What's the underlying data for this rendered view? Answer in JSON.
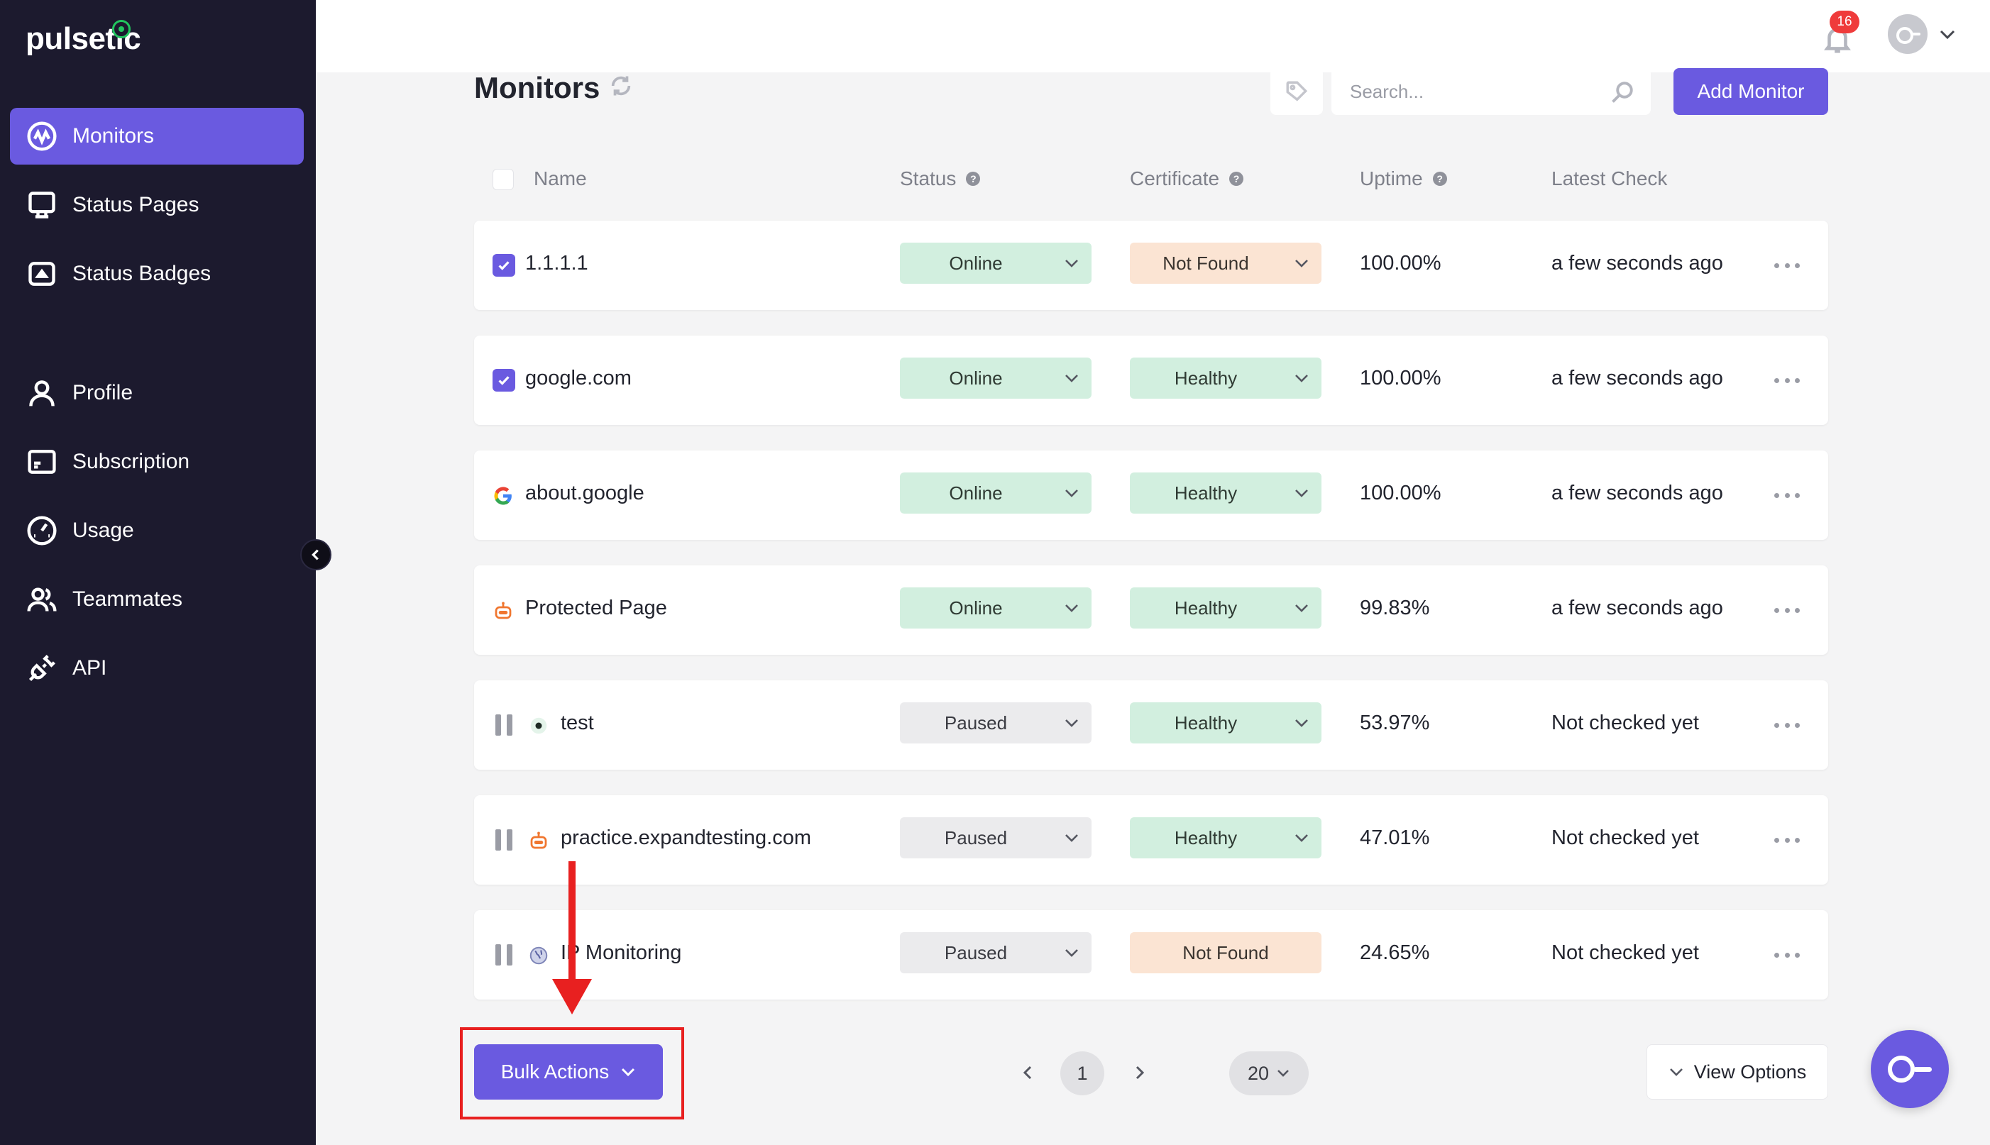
{
  "app": {
    "logo_text": "pulsetic"
  },
  "sidebar": {
    "items": [
      {
        "label": "Monitors",
        "icon": "monitor-pulse-icon",
        "active": true
      },
      {
        "label": "Status Pages",
        "icon": "display-icon"
      },
      {
        "label": "Status Badges",
        "icon": "badge-icon"
      },
      {
        "label": "Profile",
        "icon": "user-icon"
      },
      {
        "label": "Subscription",
        "icon": "credit-card-icon"
      },
      {
        "label": "Usage",
        "icon": "gauge-icon"
      },
      {
        "label": "Teammates",
        "icon": "users-icon"
      },
      {
        "label": "API",
        "icon": "plug-icon"
      }
    ]
  },
  "topbar": {
    "notification_count": "16"
  },
  "header": {
    "title": "Monitors",
    "search_placeholder": "Search...",
    "add_button": "Add Monitor"
  },
  "table": {
    "columns": {
      "name": "Name",
      "status": "Status",
      "certificate": "Certificate",
      "uptime": "Uptime",
      "latest": "Latest Check"
    },
    "rows": [
      {
        "name": "1.1.1.1",
        "status": "Online",
        "certificate": "Not Found",
        "uptime": "100.00%",
        "latest": "a few seconds ago",
        "lead": "checked",
        "site_icon": ""
      },
      {
        "name": "google.com",
        "status": "Online",
        "certificate": "Healthy",
        "uptime": "100.00%",
        "latest": "a few seconds ago",
        "lead": "checked",
        "site_icon": ""
      },
      {
        "name": "about.google",
        "status": "Online",
        "certificate": "Healthy",
        "uptime": "100.00%",
        "latest": "a few seconds ago",
        "lead": "favicon",
        "site_icon": "google-icon"
      },
      {
        "name": "Protected Page",
        "status": "Online",
        "certificate": "Healthy",
        "uptime": "99.83%",
        "latest": "a few seconds ago",
        "lead": "favicon",
        "site_icon": "robot-icon"
      },
      {
        "name": "test",
        "status": "Paused",
        "certificate": "Healthy",
        "uptime": "53.97%",
        "latest": "Not checked yet",
        "lead": "paused",
        "site_icon": "target-icon"
      },
      {
        "name": "practice.expandtesting.com",
        "status": "Paused",
        "certificate": "Healthy",
        "uptime": "47.01%",
        "latest": "Not checked yet",
        "lead": "paused",
        "site_icon": "robot-icon"
      },
      {
        "name": "IP Monitoring",
        "status": "Paused",
        "certificate": "Not Found",
        "uptime": "24.65%",
        "latest": "Not checked yet",
        "lead": "paused",
        "site_icon": "globe-icon"
      }
    ]
  },
  "footer": {
    "bulk_actions": "Bulk Actions",
    "current_page": "1",
    "per_page": "20",
    "view_options": "View Options"
  }
}
